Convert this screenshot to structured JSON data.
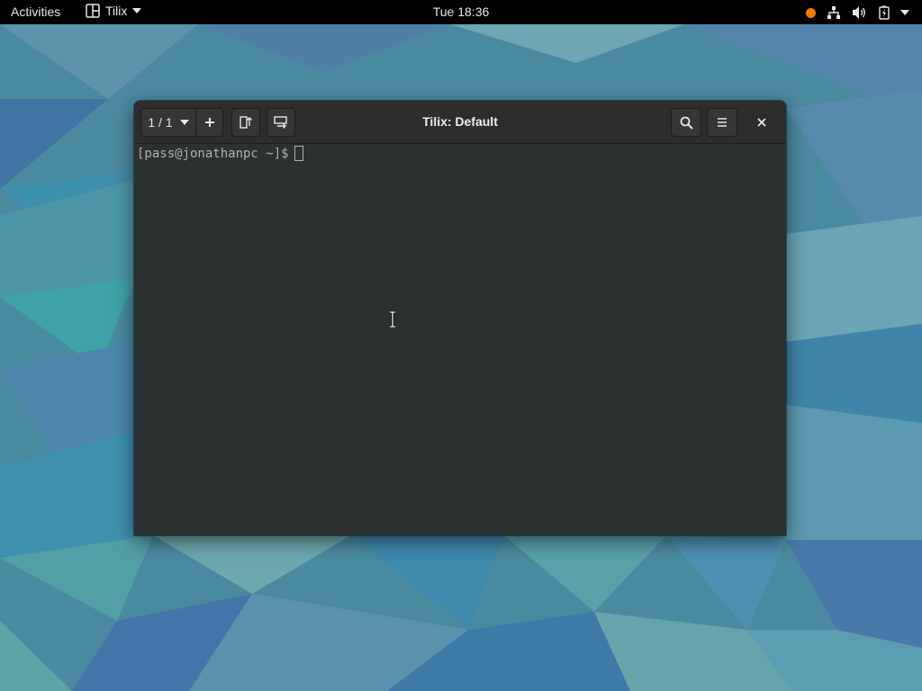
{
  "topbar": {
    "activities": "Activities",
    "app_name": "Tilix",
    "clock": "Tue 18:36"
  },
  "window": {
    "title": "Tilix: Default",
    "session_indicator": "1 / 1",
    "buttons": {
      "session_menu_icon": "chevron-down-icon",
      "add_icon": "plus-icon",
      "split_horizontal_icon": "split-right-icon",
      "split_vertical_icon": "split-down-icon",
      "search_icon": "search-icon",
      "menu_icon": "hamburger-icon",
      "close_icon": "close-icon"
    }
  },
  "terminal": {
    "prompt": "[pass@jonathanpc ~]$"
  },
  "colors": {
    "topbar_bg": "#000000",
    "headerbar_bg": "#2d2d2d",
    "terminal_bg": "#2b3030",
    "terminal_fg": "#b0b0a8",
    "status_dot": "#f57900"
  }
}
